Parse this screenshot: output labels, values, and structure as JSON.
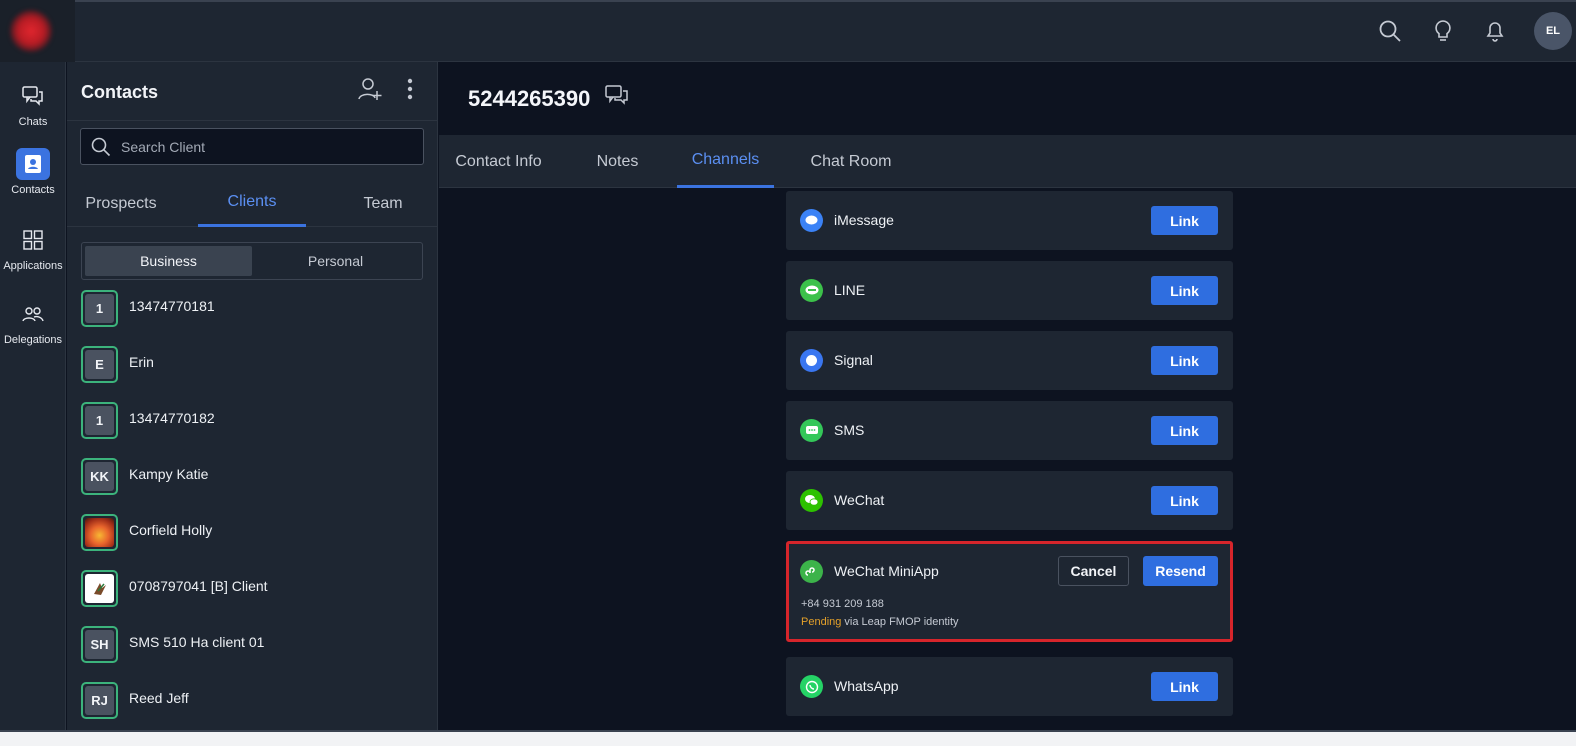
{
  "topbar": {
    "icons": [
      "search-icon",
      "lightbulb-icon",
      "bell-icon"
    ],
    "avatar_initials": "EL"
  },
  "rail": {
    "items": [
      {
        "label": "Chats",
        "icon": "chat-bubbles-icon"
      },
      {
        "label": "Contacts",
        "icon": "contact-card-icon",
        "active": true
      },
      {
        "label": "Applications",
        "icon": "grid-icon"
      },
      {
        "label": "Delegations",
        "icon": "people-icon"
      }
    ]
  },
  "contacts": {
    "title": "Contacts",
    "search_placeholder": "Search Client",
    "tabs": [
      "Prospects",
      "Clients",
      "Team"
    ],
    "active_tab": "Clients",
    "toggle": [
      "Business",
      "Personal"
    ],
    "active_toggle": "Business",
    "list": [
      {
        "initials": "1",
        "name": "13474770181"
      },
      {
        "initials": "E",
        "name": "Erin"
      },
      {
        "initials": "1",
        "name": "13474770182"
      },
      {
        "initials": "KK",
        "name": "Kampy Katie"
      },
      {
        "initials": "",
        "name": "Corfield Holly",
        "image": "flower-photo"
      },
      {
        "initials": "",
        "name": "0708797041 [B] Client",
        "image": "bird-logo"
      },
      {
        "initials": "SH",
        "name": "SMS 510 Ha client 01"
      },
      {
        "initials": "RJ",
        "name": "Reed Jeff"
      }
    ]
  },
  "main": {
    "title": "5244265390",
    "tabs": [
      "Contact Info",
      "Notes",
      "Channels",
      "Chat Room"
    ],
    "active_tab": "Channels",
    "link_label": "Link",
    "channels": [
      {
        "name": "iMessage",
        "color": "#3b82f6"
      },
      {
        "name": "LINE",
        "color": "#3cc14a"
      },
      {
        "name": "Signal",
        "color": "#3a76f0"
      },
      {
        "name": "SMS",
        "color": "#34c759"
      },
      {
        "name": "WeChat",
        "color": "#2dc100"
      },
      {
        "name": "WeChat MiniApp",
        "color": "#3cb34a",
        "phone": "+84 931 209 188",
        "status": "Pending",
        "status_suffix": " via Leap FMOP identity",
        "cancel_label": "Cancel",
        "resend_label": "Resend"
      },
      {
        "name": "WhatsApp",
        "color": "#25d366"
      }
    ]
  }
}
